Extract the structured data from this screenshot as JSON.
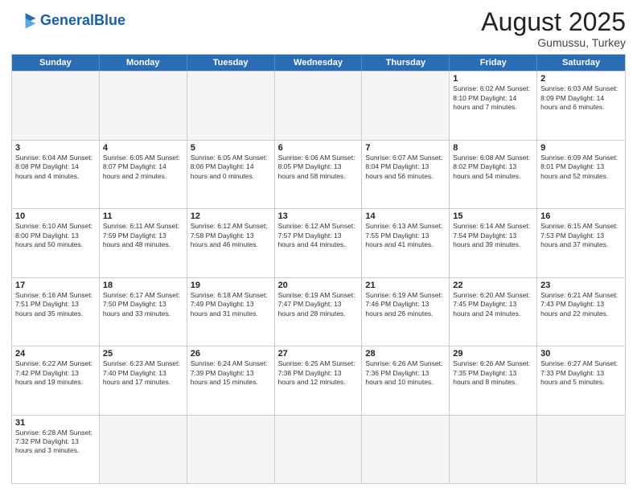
{
  "header": {
    "logo_general": "General",
    "logo_blue": "Blue",
    "month_year": "August 2025",
    "location": "Gumussu, Turkey"
  },
  "weekdays": [
    "Sunday",
    "Monday",
    "Tuesday",
    "Wednesday",
    "Thursday",
    "Friday",
    "Saturday"
  ],
  "rows": [
    [
      {
        "day": "",
        "info": "",
        "empty": true
      },
      {
        "day": "",
        "info": "",
        "empty": true
      },
      {
        "day": "",
        "info": "",
        "empty": true
      },
      {
        "day": "",
        "info": "",
        "empty": true
      },
      {
        "day": "",
        "info": "",
        "empty": true
      },
      {
        "day": "1",
        "info": "Sunrise: 6:02 AM\nSunset: 8:10 PM\nDaylight: 14 hours\nand 7 minutes."
      },
      {
        "day": "2",
        "info": "Sunrise: 6:03 AM\nSunset: 8:09 PM\nDaylight: 14 hours\nand 6 minutes."
      }
    ],
    [
      {
        "day": "3",
        "info": "Sunrise: 6:04 AM\nSunset: 8:08 PM\nDaylight: 14 hours\nand 4 minutes."
      },
      {
        "day": "4",
        "info": "Sunrise: 6:05 AM\nSunset: 8:07 PM\nDaylight: 14 hours\nand 2 minutes."
      },
      {
        "day": "5",
        "info": "Sunrise: 6:05 AM\nSunset: 8:06 PM\nDaylight: 14 hours\nand 0 minutes."
      },
      {
        "day": "6",
        "info": "Sunrise: 6:06 AM\nSunset: 8:05 PM\nDaylight: 13 hours\nand 58 minutes."
      },
      {
        "day": "7",
        "info": "Sunrise: 6:07 AM\nSunset: 8:04 PM\nDaylight: 13 hours\nand 56 minutes."
      },
      {
        "day": "8",
        "info": "Sunrise: 6:08 AM\nSunset: 8:02 PM\nDaylight: 13 hours\nand 54 minutes."
      },
      {
        "day": "9",
        "info": "Sunrise: 6:09 AM\nSunset: 8:01 PM\nDaylight: 13 hours\nand 52 minutes."
      }
    ],
    [
      {
        "day": "10",
        "info": "Sunrise: 6:10 AM\nSunset: 8:00 PM\nDaylight: 13 hours\nand 50 minutes."
      },
      {
        "day": "11",
        "info": "Sunrise: 6:11 AM\nSunset: 7:59 PM\nDaylight: 13 hours\nand 48 minutes."
      },
      {
        "day": "12",
        "info": "Sunrise: 6:12 AM\nSunset: 7:58 PM\nDaylight: 13 hours\nand 46 minutes."
      },
      {
        "day": "13",
        "info": "Sunrise: 6:12 AM\nSunset: 7:57 PM\nDaylight: 13 hours\nand 44 minutes."
      },
      {
        "day": "14",
        "info": "Sunrise: 6:13 AM\nSunset: 7:55 PM\nDaylight: 13 hours\nand 41 minutes."
      },
      {
        "day": "15",
        "info": "Sunrise: 6:14 AM\nSunset: 7:54 PM\nDaylight: 13 hours\nand 39 minutes."
      },
      {
        "day": "16",
        "info": "Sunrise: 6:15 AM\nSunset: 7:53 PM\nDaylight: 13 hours\nand 37 minutes."
      }
    ],
    [
      {
        "day": "17",
        "info": "Sunrise: 6:16 AM\nSunset: 7:51 PM\nDaylight: 13 hours\nand 35 minutes."
      },
      {
        "day": "18",
        "info": "Sunrise: 6:17 AM\nSunset: 7:50 PM\nDaylight: 13 hours\nand 33 minutes."
      },
      {
        "day": "19",
        "info": "Sunrise: 6:18 AM\nSunset: 7:49 PM\nDaylight: 13 hours\nand 31 minutes."
      },
      {
        "day": "20",
        "info": "Sunrise: 6:19 AM\nSunset: 7:47 PM\nDaylight: 13 hours\nand 28 minutes."
      },
      {
        "day": "21",
        "info": "Sunrise: 6:19 AM\nSunset: 7:46 PM\nDaylight: 13 hours\nand 26 minutes."
      },
      {
        "day": "22",
        "info": "Sunrise: 6:20 AM\nSunset: 7:45 PM\nDaylight: 13 hours\nand 24 minutes."
      },
      {
        "day": "23",
        "info": "Sunrise: 6:21 AM\nSunset: 7:43 PM\nDaylight: 13 hours\nand 22 minutes."
      }
    ],
    [
      {
        "day": "24",
        "info": "Sunrise: 6:22 AM\nSunset: 7:42 PM\nDaylight: 13 hours\nand 19 minutes."
      },
      {
        "day": "25",
        "info": "Sunrise: 6:23 AM\nSunset: 7:40 PM\nDaylight: 13 hours\nand 17 minutes."
      },
      {
        "day": "26",
        "info": "Sunrise: 6:24 AM\nSunset: 7:39 PM\nDaylight: 13 hours\nand 15 minutes."
      },
      {
        "day": "27",
        "info": "Sunrise: 6:25 AM\nSunset: 7:38 PM\nDaylight: 13 hours\nand 12 minutes."
      },
      {
        "day": "28",
        "info": "Sunrise: 6:26 AM\nSunset: 7:36 PM\nDaylight: 13 hours\nand 10 minutes."
      },
      {
        "day": "29",
        "info": "Sunrise: 6:26 AM\nSunset: 7:35 PM\nDaylight: 13 hours\nand 8 minutes."
      },
      {
        "day": "30",
        "info": "Sunrise: 6:27 AM\nSunset: 7:33 PM\nDaylight: 13 hours\nand 5 minutes."
      }
    ],
    [
      {
        "day": "31",
        "info": "Sunrise: 6:28 AM\nSunset: 7:32 PM\nDaylight: 13 hours\nand 3 minutes."
      },
      {
        "day": "",
        "info": "",
        "empty": true
      },
      {
        "day": "",
        "info": "",
        "empty": true
      },
      {
        "day": "",
        "info": "",
        "empty": true
      },
      {
        "day": "",
        "info": "",
        "empty": true
      },
      {
        "day": "",
        "info": "",
        "empty": true
      },
      {
        "day": "",
        "info": "",
        "empty": true
      }
    ]
  ]
}
